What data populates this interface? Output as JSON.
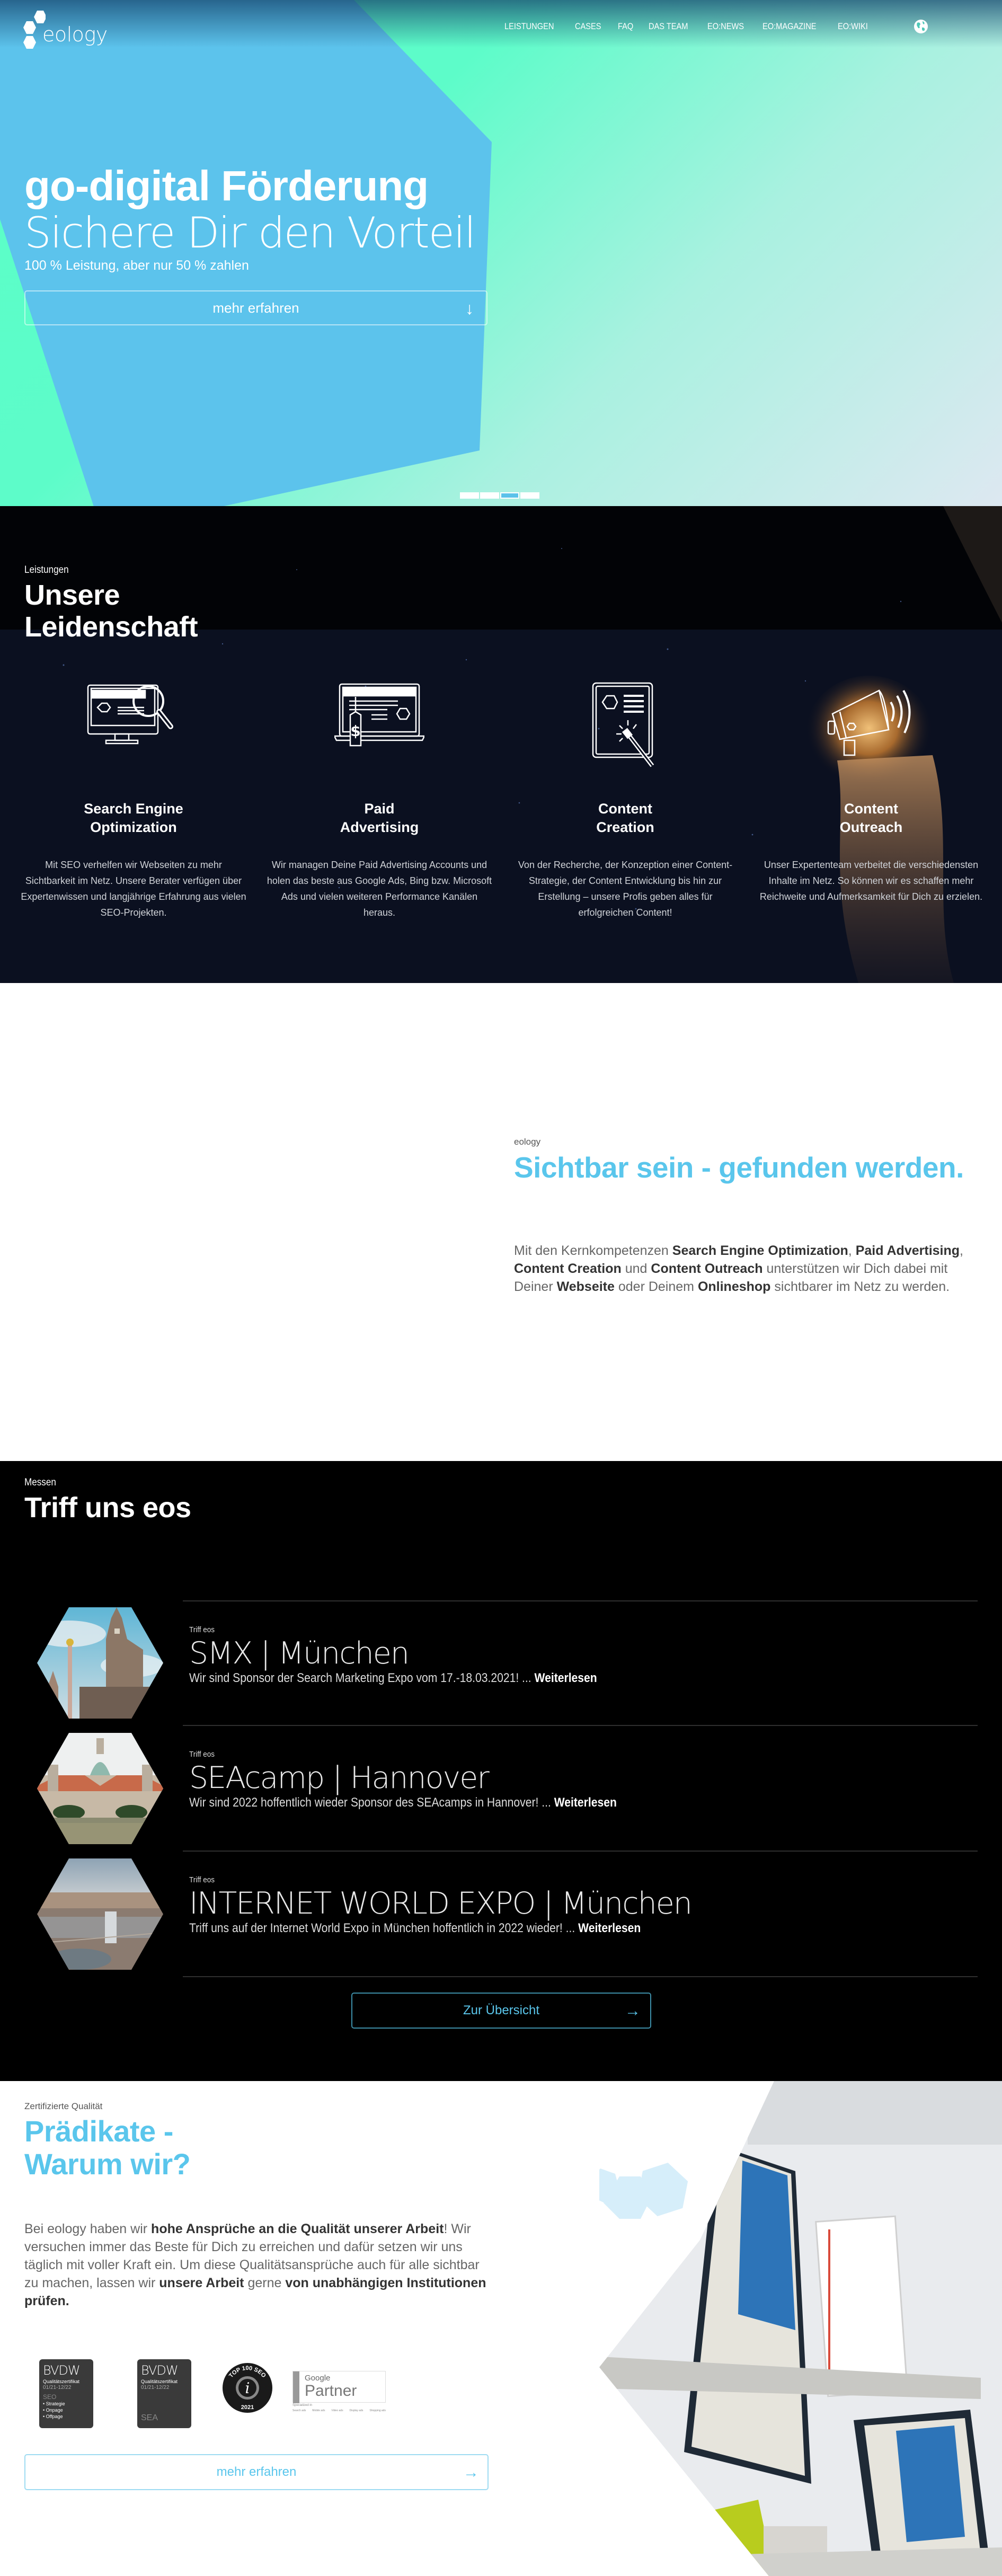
{
  "brand": {
    "logo_text": "eology",
    "colors": {
      "accent": "#5ac6ec",
      "mint": "#5bffc8",
      "dark": "#000000"
    }
  },
  "nav": {
    "items": [
      "LEISTUNGEN",
      "CASES",
      "FAQ",
      "DAS TEAM",
      "EO:NEWS",
      "EO:MAGAZINE",
      "EO:WIKI"
    ],
    "language_icon": "globe-icon"
  },
  "hero": {
    "title": "go-digital Förderung",
    "subtitle": "Sichere Dir den Vorteil",
    "note": "100 % Leistung, aber nur 50 % zahlen",
    "button_label": "mehr erfahren",
    "button_icon": "arrow-down-icon",
    "slides_total": 4,
    "slide_active": 3
  },
  "services": {
    "kicker": "Leistungen",
    "title_line1": "Unsere",
    "title_line2": "Leidenschaft",
    "items": [
      {
        "icon": "monitor-search-icon",
        "title_line1": "Search Engine",
        "title_line2": "Optimization",
        "desc": "Mit SEO verhelfen wir Webseiten zu mehr Sichtbarkeit im Netz. Unsere Berater verfügen über Expertenwissen und langjährige Erfahrung aus vielen SEO-Projekten."
      },
      {
        "icon": "laptop-price-tag-icon",
        "title_line1": "Paid",
        "title_line2": "Advertising",
        "desc": "Wir managen Deine Paid Advertising Accounts und holen das beste aus Google Ads, Bing bzw. Microsoft Ads und vielen weiteren Performance Kanälen heraus."
      },
      {
        "icon": "tablet-magic-wand-icon",
        "title_line1": "Content",
        "title_line2": "Creation",
        "desc": "Von der Recherche, der Konzeption einer Content-Strategie, der Content Entwicklung bis hin zur Erstellung – unsere Profis geben alles für erfolgreichen Content!"
      },
      {
        "icon": "megaphone-icon",
        "title_line1": "Content",
        "title_line2": "Outreach",
        "desc": "Unser Expertenteam verbeitet die verschiedensten Inhalte im Netz. So können wir es schaffen mehr Reichweite und Aufmerksamkeit für Dich zu erzielen."
      }
    ]
  },
  "visible": {
    "kicker": "eology",
    "title": "Sichtbar sein - gefunden werden.",
    "text": {
      "p1": "Mit den Kernkompetenzen ",
      "b1": "Search Engine Optimization",
      "p2": ", ",
      "b2": "Paid Advertising",
      "p3": ", ",
      "b3": "Content Creation",
      "p4": " und ",
      "b4": "Content Outreach",
      "p5": " unterstützen wir Dich dabei mit Deiner ",
      "b5": "Webseite",
      "p6": " oder Deinem ",
      "b6": "Onlineshop",
      "p7": " sichtbarer im Netz zu werden."
    }
  },
  "events": {
    "kicker": "Messen",
    "title": "Triff uns eos",
    "items": [
      {
        "kicker": "Triff eos",
        "title": "SMX | München",
        "desc": "Wir sind Sponsor der Search Marketing Expo vom 17.-18.03.2021! ... ",
        "link": "Weiterlesen",
        "image_alt": "munich-town-hall-image"
      },
      {
        "kicker": "Triff eos",
        "title": "SEAcamp | Hannover",
        "desc": "Wir sind 2022 hoffentlich wieder Sponsor des SEAcamps in Hannover!  ... ",
        "link": "Weiterlesen",
        "image_alt": "hannover-town-hall-image"
      },
      {
        "kicker": "Triff eos",
        "title": "INTERNET WORLD EXPO | München",
        "desc": "Triff uns auf der Internet World Expo in München hoffentlich in 2022 wieder!  ... ",
        "link": "Weiterlesen",
        "image_alt": "munich-aerial-image"
      }
    ],
    "overview_button": "Zur Übersicht"
  },
  "quality": {
    "kicker": "Zertifizierte Qualität",
    "title_line1": "Prädikate -",
    "title_line2": "Warum wir?",
    "text": {
      "p1": "Bei eology haben wir ",
      "b1": "hohe Ansprüche an die Qualität unserer Arbeit",
      "p2": "! Wir versuchen immer das Beste für Dich zu erreichen und dafür setzen wir uns täglich mit voller Kraft ein. Um diese Qualitätsansprüche auch für alle sichtbar zu machen, lassen wir ",
      "b2": "unsere Arbeit",
      "p3": " gerne ",
      "b3": "von unabhängigen Institutionen prüfen."
    },
    "badges": {
      "bvdw_seo": {
        "name": "BVDW",
        "label": "Qualitätszertifikat",
        "period": "01/21-12/22",
        "area": "SEO",
        "points": [
          "• Strategie",
          "• Onpage",
          "• Offpage"
        ]
      },
      "bvdw_sea": {
        "name": "BVDW",
        "label": "Qualitätszertifikat",
        "period": "01/21-12/22",
        "area": "SEA"
      },
      "top100": {
        "top": "TOP 100 SEO",
        "year": "2021"
      },
      "google": {
        "tier": "PREMIER",
        "brand": "Google",
        "name": "Partner",
        "specialized": "Specialized in",
        "items": [
          "Search ads",
          "Mobile ads",
          "Video ads",
          "Display ads",
          "Shopping ads"
        ]
      }
    },
    "button_label": "mehr erfahren"
  }
}
